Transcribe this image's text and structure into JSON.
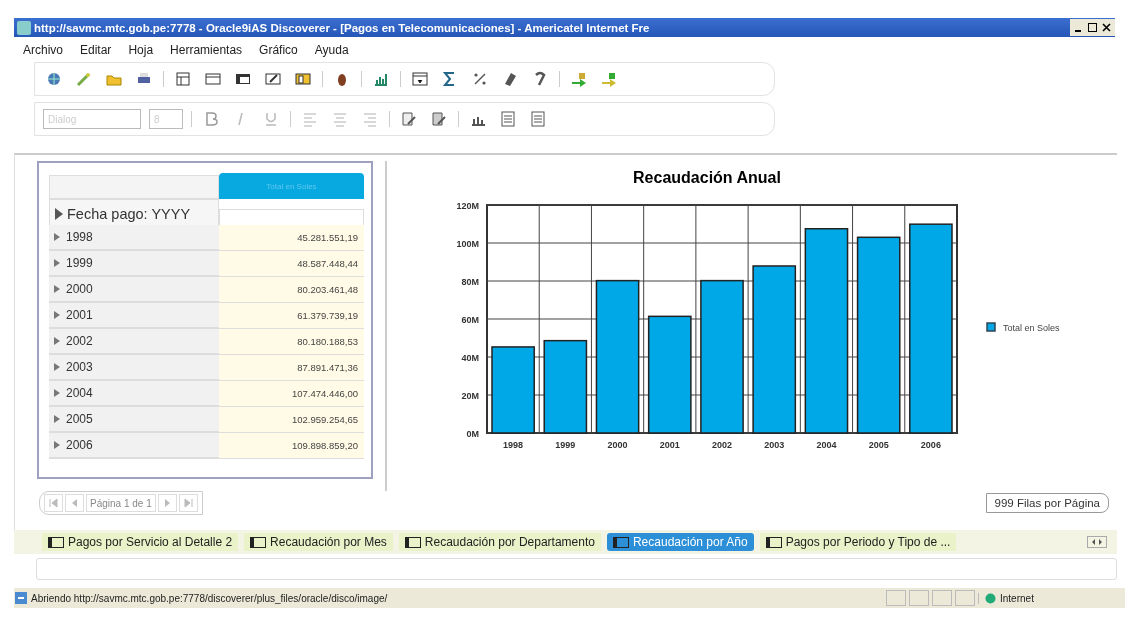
{
  "window": {
    "title": "http://savmc.mtc.gob.pe:7778 - Oracle9iAS Discoverer - [Pagos en Telecomunicaciones] - Americatel Internet Fre"
  },
  "menu": [
    "Archivo",
    "Editar",
    "Hoja",
    "Herramientas",
    "Gráfico",
    "Ayuda"
  ],
  "format_toolbar": {
    "font": "Dialog",
    "size": "8"
  },
  "table": {
    "column_header": "Total en Soles",
    "row_header": "Fecha pago: YYYY",
    "rows": [
      {
        "label": "1998",
        "value": "45.281.551,19"
      },
      {
        "label": "1999",
        "value": "48.587.448,44"
      },
      {
        "label": "2000",
        "value": "80.203.461,48"
      },
      {
        "label": "2001",
        "value": "61.379.739,19"
      },
      {
        "label": "2002",
        "value": "80.180.188,53"
      },
      {
        "label": "2003",
        "value": "87.891.471,36"
      },
      {
        "label": "2004",
        "value": "107.474.446,00"
      },
      {
        "label": "2005",
        "value": "102.959.254,65"
      },
      {
        "label": "2006",
        "value": "109.898.859,20"
      }
    ]
  },
  "chart": {
    "chart_data": {
      "type": "bar",
      "title": "Recaudación Anual",
      "categories": [
        "1998",
        "1999",
        "2000",
        "2001",
        "2002",
        "2003",
        "2004",
        "2005",
        "2006"
      ],
      "series": [
        {
          "name": "Total en Soles",
          "color": "#00a8e8",
          "values": [
            45.3,
            48.6,
            80.2,
            61.4,
            80.2,
            87.9,
            107.5,
            103.0,
            109.9
          ]
        }
      ],
      "grid": true,
      "ylim": [
        0,
        120
      ],
      "yticks": [
        {
          "value": 0,
          "label": "0M"
        },
        {
          "value": 20,
          "label": "20M"
        },
        {
          "value": 40,
          "label": "40M"
        },
        {
          "value": 60,
          "label": "60M"
        },
        {
          "value": 80,
          "label": "80M"
        },
        {
          "value": 100,
          "label": "100M"
        },
        {
          "value": 120,
          "label": "120M"
        }
      ]
    }
  },
  "pager": {
    "page": "Página 1 de 1",
    "rows_per_page": "999 Filas por Página"
  },
  "sheet_tabs": [
    {
      "label": "Pagos por Servicio al Detalle 2",
      "selected": false
    },
    {
      "label": "Recaudación por Mes",
      "selected": false
    },
    {
      "label": "Recaudación por Departamento",
      "selected": false
    },
    {
      "label": "Recaudación por Año",
      "selected": true
    },
    {
      "label": "Pagos por Periodo y Tipo de ...",
      "selected": false
    }
  ],
  "status_bar": {
    "message": "Abriendo http://savmc.mtc.gob.pe:7778/discoverer/plus_files/oracle/disco/image/",
    "zone": "Internet"
  }
}
